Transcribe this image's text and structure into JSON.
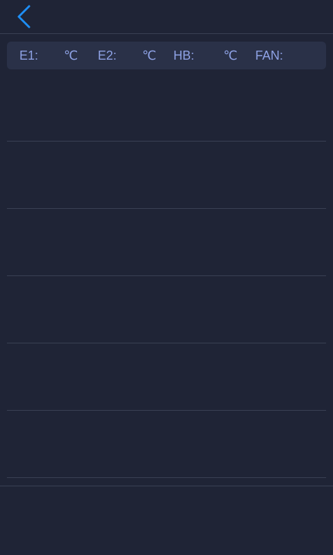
{
  "header": {
    "back_icon": "chevron-left-icon",
    "accent_color": "#1e8ef5"
  },
  "status": {
    "e1_label": "E1:",
    "e1_unit": "℃",
    "e2_label": "E2:",
    "e2_unit": "℃",
    "hb_label": "HB:",
    "hb_unit": "℃",
    "fan_label": "FAN:"
  },
  "colors": {
    "background": "#1f2436",
    "panel": "#2a3148",
    "label_text": "#8fa3e6",
    "divider": "#3a4154"
  }
}
